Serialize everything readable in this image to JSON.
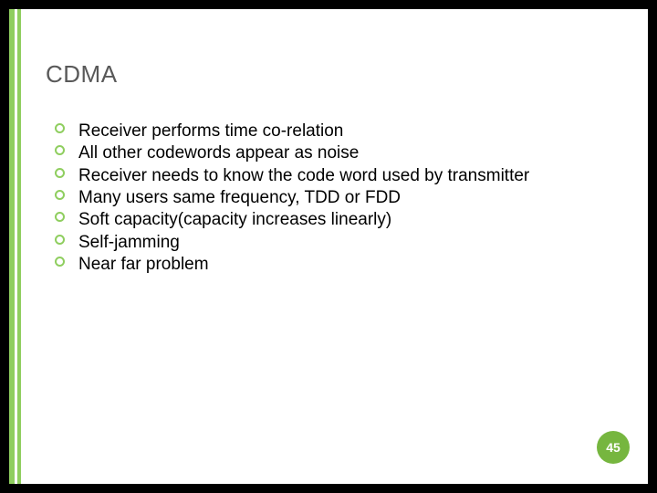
{
  "title": "CDMA",
  "bullets": [
    "Receiver performs time co-relation",
    "All other codewords appear as noise",
    "Receiver needs to know the code word used by transmitter",
    "Many users same frequency, TDD or FDD",
    "Soft capacity(capacity increases linearly)",
    "Self-jamming",
    "Near far problem"
  ],
  "page_number": "45",
  "accent_color": "#8fce5f",
  "badge_color": "#76b63f"
}
